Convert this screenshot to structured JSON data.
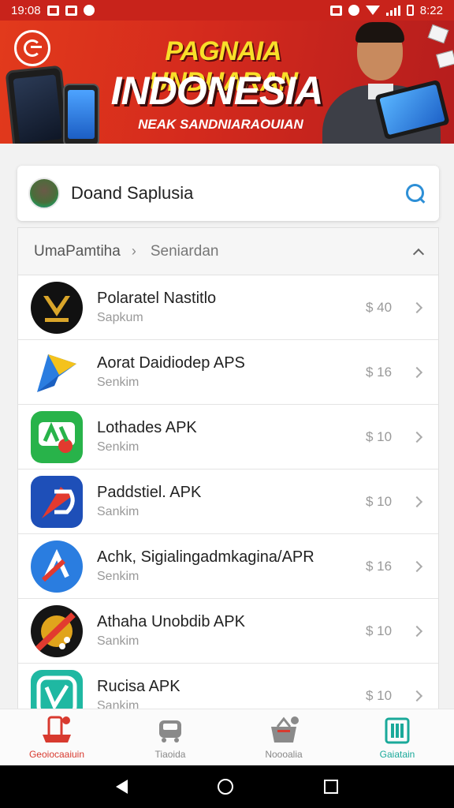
{
  "status_bar": {
    "time": "19:08",
    "right_time": "8:22"
  },
  "banner": {
    "title": "PAGNAIA UNDUARAN",
    "headline": "INDONESIA",
    "tagline": "NEAK SANDNIARAOUIAN"
  },
  "search": {
    "text": "Doand Saplusia"
  },
  "breadcrumb": {
    "parent": "UmaPamtiha",
    "current": "Seniardan"
  },
  "apps": [
    {
      "name": "Polaratel Nastitlo",
      "sub": "Sapkum",
      "price": "$ 40"
    },
    {
      "name": "Aorat Daidiodep APS",
      "sub": "Senkim",
      "price": "$ 16"
    },
    {
      "name": "Lothades APK",
      "sub": "Senkim",
      "price": "$ 10"
    },
    {
      "name": "Paddstiel. APK",
      "sub": "Sankim",
      "price": "$ 10"
    },
    {
      "name": "Achk, Sigialingadmkagina/APR",
      "sub": "Senkim",
      "price": "$ 16"
    },
    {
      "name": "Athaha Unobdib APK",
      "sub": "Sankim",
      "price": "$ 10"
    },
    {
      "name": "Rucisa APK",
      "sub": "Sankim",
      "price": "$ 10"
    }
  ],
  "nav": [
    {
      "label": "Geoiocaaiuin",
      "icon": "phone-cart-icon",
      "color": "#d83a2f"
    },
    {
      "label": "Tiaoida",
      "icon": "car-icon",
      "color": "#888888"
    },
    {
      "label": "Noooalia",
      "icon": "basket-icon",
      "color": "#888888"
    },
    {
      "label": "Gaiatain",
      "icon": "clipboard-icon",
      "color": "#1aa99a"
    }
  ],
  "colors": {
    "brand_red": "#c8231b",
    "accent_blue": "#2d8fd6",
    "active_teal": "#1aa99a"
  }
}
